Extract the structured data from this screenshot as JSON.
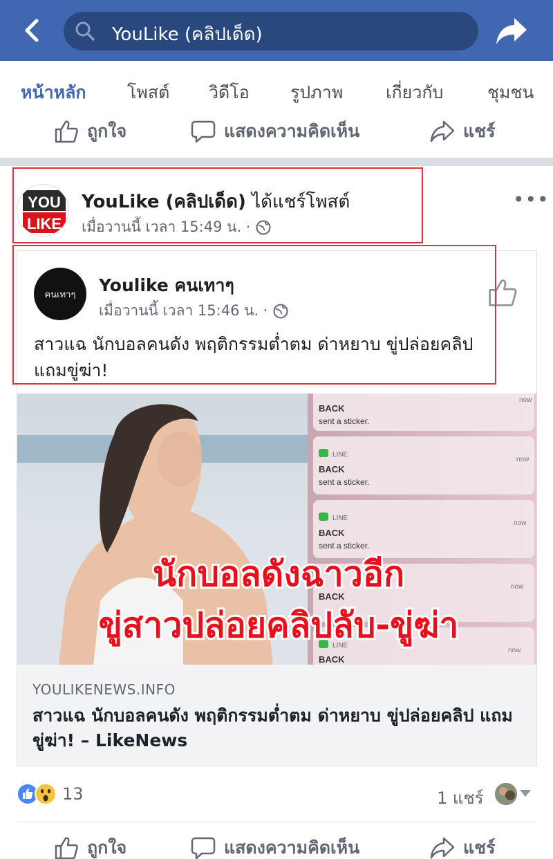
{
  "topbar": {
    "search_text": "YouLike (คลิปเด็ด)",
    "bg_color": "#4267b2",
    "icons": [
      "back-arrow-icon",
      "search-icon",
      "share-arrow-icon"
    ]
  },
  "tabs": [
    {
      "label": "หน้าหลัก",
      "active": true
    },
    {
      "label": "โพสต์",
      "active": false
    },
    {
      "label": "วิดีโอ",
      "active": false
    },
    {
      "label": "รูปภาพ",
      "active": false
    },
    {
      "label": "เกี่ยวกับ",
      "active": false
    },
    {
      "label": "ชุมชน",
      "active": false
    }
  ],
  "actions": {
    "like": "ถูกใจ",
    "comment": "แสดงความคิดเห็น",
    "share": "แชร์"
  },
  "post": {
    "avatar_text_top": "YOU",
    "avatar_text_bottom": "LIKE",
    "page_name": "YouLike (คลิปเด็ด)",
    "action_text": "ได้แชร์โพสต์",
    "time": "เมื่อวานนี้ เวลา 15:49 น. ·",
    "more_label": "•••"
  },
  "shared": {
    "avatar_text": "คนเทาๆ",
    "name": "Youlike คนเทาๆ",
    "time": "เมื่อวานนี้ เวลา 15:46 น. ·",
    "text": "สาวแฉ นักบอลคนดัง พฤติกรรมต่ำตม ด่าหยาบ ขู่ปล่อยคลิป แถมขู่ฆ่า!",
    "image": {
      "headline_line1": "นักบอลดังฉาวอีก",
      "headline_line2": "ขู่สาวปล่อยคลิปลับ-ขู่ฆ่า",
      "notifications": [
        {
          "app": "",
          "sender": "BACK",
          "message": "sent a sticker.",
          "time": "now"
        },
        {
          "app": "LINE",
          "sender": "BACK",
          "message": "sent a sticker.",
          "time": "now"
        },
        {
          "app": "LINE",
          "sender": "BACK",
          "message": "sent a sticker.",
          "time": "now"
        },
        {
          "app": "",
          "sender": "BACK",
          "message": "",
          "time": "now"
        },
        {
          "app": "LINE",
          "sender": "BACK",
          "message": "",
          "time": "now"
        }
      ]
    },
    "link_domain": "YOULIKENEWS.INFO",
    "link_title": "สาวแฉ นักบอลคนดัง พฤติกรรมต่ำตม ด่าหยาบ ขู่ปล่อยคลิป แถมขู่ฆ่า! – LikeNews"
  },
  "reactions": {
    "count": "13",
    "types": [
      "like-reaction-icon",
      "wow-reaction-icon"
    ],
    "shares": "1 แชร์"
  },
  "colors": {
    "fb_blue": "#4267b2",
    "highlight_red": "#e0303a",
    "headline_red": "#e8101c"
  }
}
